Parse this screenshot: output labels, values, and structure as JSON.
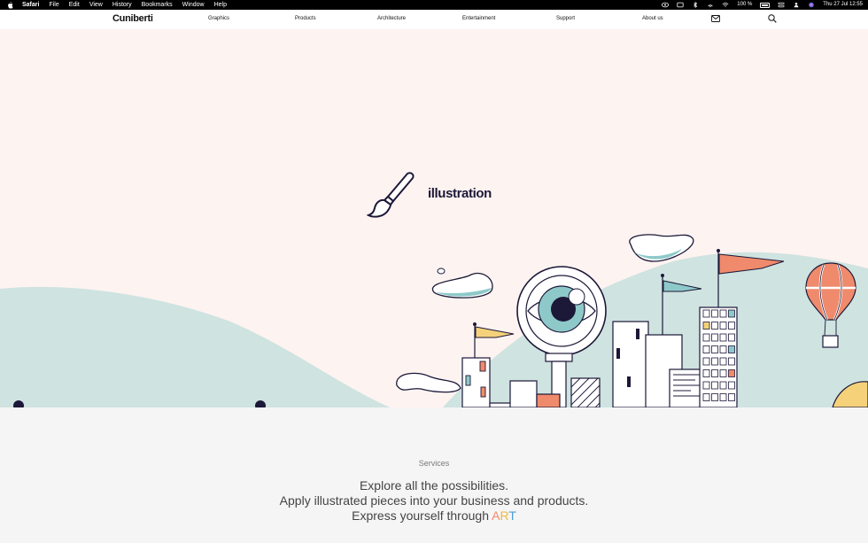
{
  "menubar": {
    "app": "Safari",
    "items": [
      "File",
      "Edit",
      "View",
      "History",
      "Bookmarks",
      "Window",
      "Help"
    ],
    "battery": "100 %",
    "datetime": "Thu 27 Jul  12:55"
  },
  "nav": {
    "logo": "Cuniberti",
    "links": [
      "Graphics",
      "Products",
      "Architecture",
      "Entertainment",
      "Support",
      "About us"
    ]
  },
  "hero": {
    "title": "illustration"
  },
  "services": {
    "label": "Services",
    "line1": "Explore all the possibilities.",
    "line2": "Apply illustrated pieces into your business and products.",
    "line3_prefix": "Express yourself through ",
    "art_a": "A",
    "art_r": "R",
    "art_t": "T"
  },
  "colors": {
    "hero_bg": "#fdf3f1",
    "hill": "#cfe3e0",
    "accent_orange": "#f08a6c",
    "accent_yellow": "#f5d27a",
    "accent_teal": "#8ec9c9",
    "ink": "#1c1838"
  }
}
